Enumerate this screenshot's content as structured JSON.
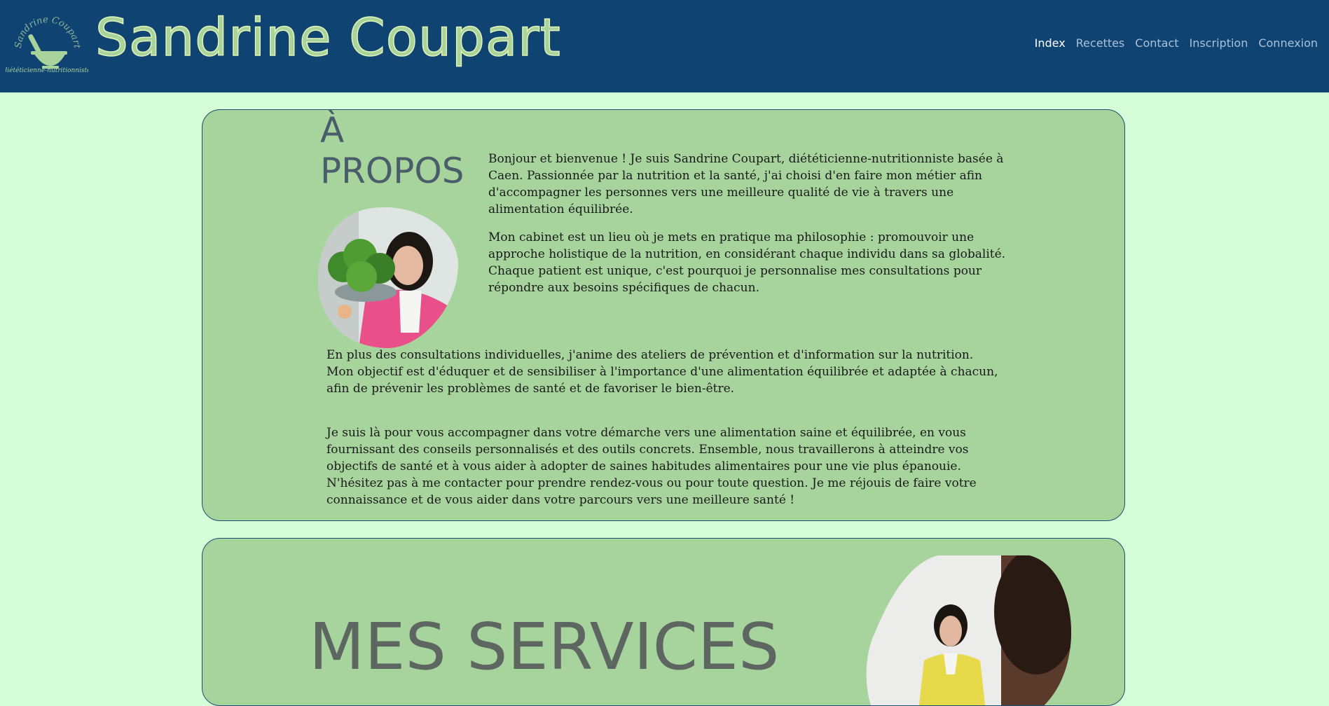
{
  "header": {
    "logo": {
      "circle_text": "Sandrine Coupart",
      "tagline": "diététicienne-nutritionniste",
      "icon": "mortar-pestle-icon"
    },
    "title": "Sandrine Coupart",
    "nav": [
      {
        "label": "Index",
        "active": true
      },
      {
        "label": "Recettes",
        "active": false
      },
      {
        "label": "Contact",
        "active": false
      },
      {
        "label": "Inscription",
        "active": false
      },
      {
        "label": "Connexion",
        "active": false
      }
    ]
  },
  "about": {
    "heading_line1": "À",
    "heading_line2": "PROPOS",
    "paragraphs": [
      "Bonjour et bienvenue ! Je suis Sandrine Coupart, diététicienne-nutritionniste basée à Caen. Passionnée par la nutrition et la santé, j'ai choisi d'en faire mon métier afin d'accompagner les personnes vers une meilleure qualité de vie à travers une alimentation équilibrée.",
      "Mon cabinet est un lieu où je mets en pratique ma philosophie : promouvoir une approche holistique de la nutrition, en considérant chaque individu dans sa globalité. Chaque patient est unique, c'est pourquoi je personnalise mes consultations pour répondre aux besoins spécifiques de chacun.",
      "En plus des consultations individuelles, j'anime des ateliers de prévention et d'information sur la nutrition. Mon objectif est d'éduquer et de sensibiliser à l'importance d'une alimentation équilibrée et adaptée à chacun, afin de prévenir les problèmes de santé et de favoriser le bien-être.",
      "Je suis là pour vous accompagner dans votre démarche vers une alimentation saine et équilibrée, en vous fournissant des conseils personnalisés et des outils concrets. Ensemble, nous travaillerons à atteindre vos objectifs de santé et à vous aider à adopter de saines habitudes alimentaires pour une vie plus épanouie. N'hésitez pas à me contacter pour prendre rendez-vous ou pour toute question. Je me réjouis de faire votre connaissance et de vous aider dans votre parcours vers une meilleure santé !"
    ]
  },
  "services": {
    "heading": "MES SERVICES"
  },
  "colors": {
    "header_bg": "#0f4372",
    "page_bg": "#d4fdd8",
    "card_bg": "#a6d49c",
    "title_green": "#a8d49c",
    "nav_active": "#ffffff",
    "nav_inactive": "#a9c1d9"
  }
}
